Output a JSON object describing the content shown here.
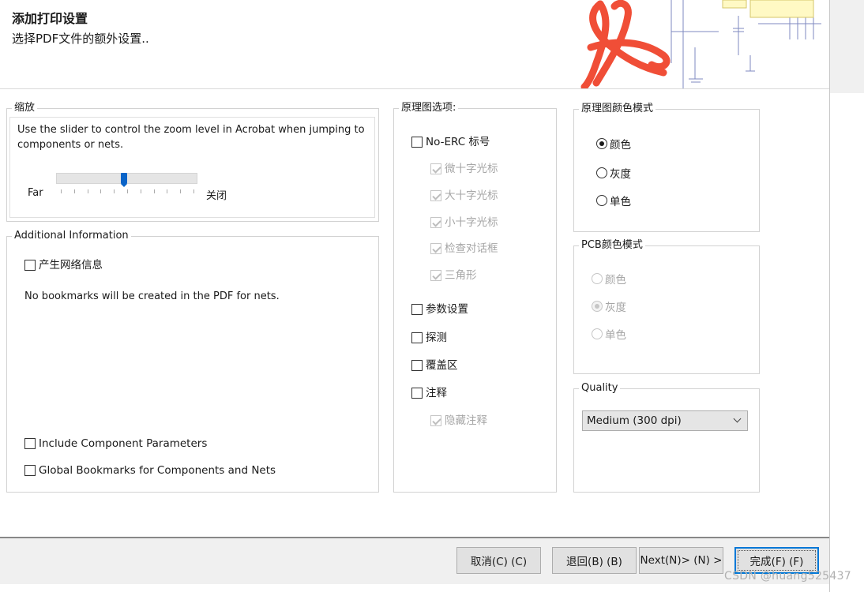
{
  "header": {
    "title": "添加打印设置",
    "subtitle": "选择PDF文件的额外设置.."
  },
  "zoom": {
    "legend": "缩放",
    "description": "Use the slider to control the zoom level in Acrobat when jumping to components or nets.",
    "left_label": "Far",
    "right_label": "关闭",
    "slider_level_fraction": 0.48
  },
  "additional": {
    "legend": "Additional Information",
    "net_info_label": "产生网络信息",
    "note": "No bookmarks will be created in the PDF for nets.",
    "include_params_label": "Include Component Parameters",
    "global_bookmarks_label": "Global Bookmarks for Components and Nets"
  },
  "schematic": {
    "legend": "原理图选项:",
    "no_erc_label": "No-ERC 标号",
    "sub_options": [
      "微十字光标",
      "大十字光标",
      "小十字光标",
      "检查对话框",
      "三角形"
    ],
    "param_label": "参数设置",
    "probe_label": "探测",
    "cover_label": "覆盖区",
    "notes_label": "注释",
    "hide_notes_label": "隐藏注释"
  },
  "sch_color": {
    "legend": "原理图颜色模式",
    "options": [
      "颜色",
      "灰度",
      "单色"
    ],
    "selected": "颜色"
  },
  "pcb_color": {
    "legend": "PCB颜色模式",
    "options": [
      "颜色",
      "灰度",
      "单色"
    ],
    "selected": "灰度"
  },
  "quality": {
    "legend": "Quality",
    "value": "Medium (300 dpi)"
  },
  "buttons": {
    "cancel": "取消(C) (C)",
    "back": "退回(B) (B)",
    "next": "Next(N)> (N) >",
    "finish": "完成(F) (F)"
  },
  "watermark": "CSDN @huang525437",
  "colors": {
    "acrobat_red": "#f04e37",
    "accent_blue": "#0078d7",
    "thumb_blue": "#0a64c8"
  }
}
